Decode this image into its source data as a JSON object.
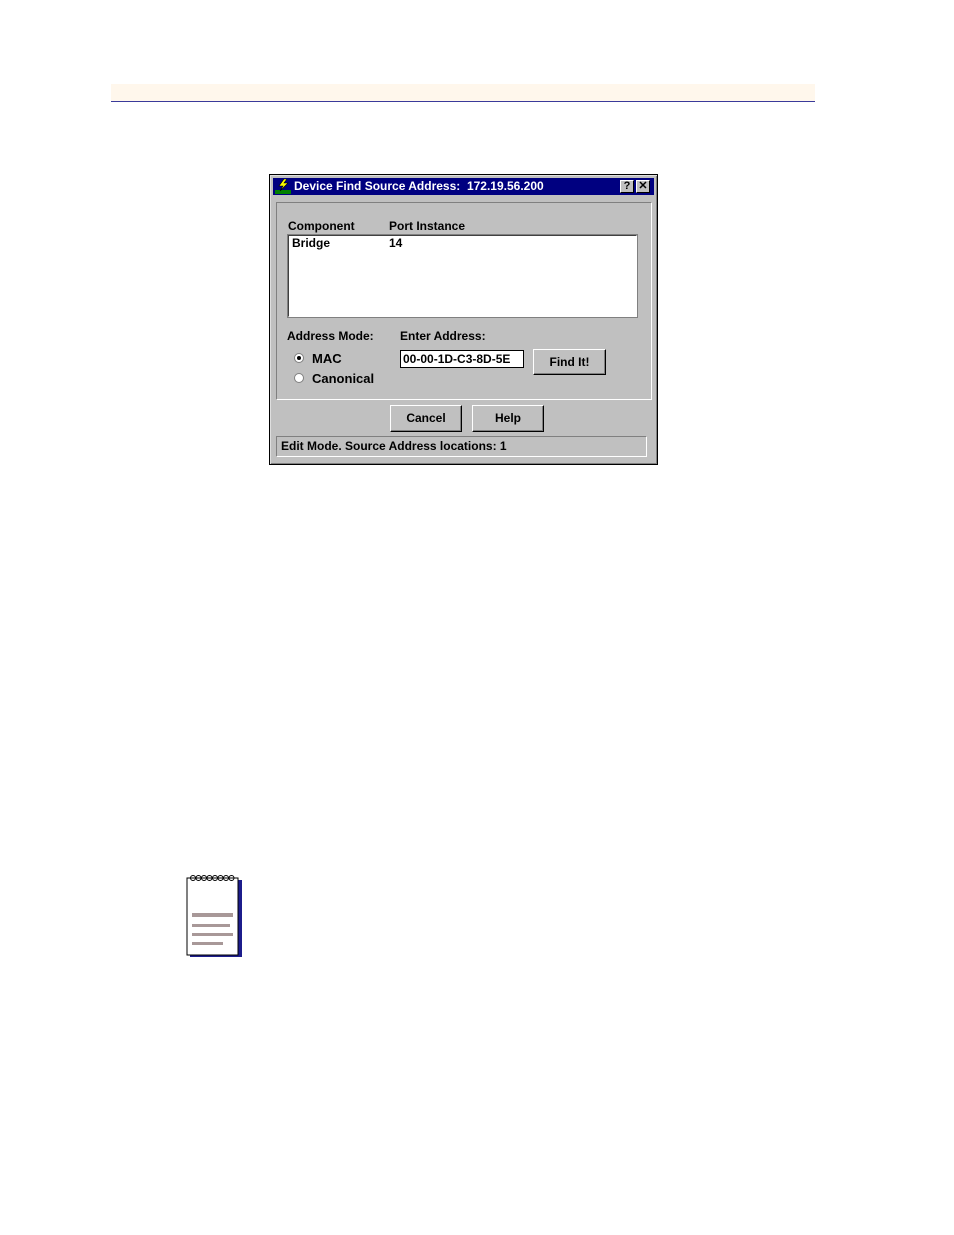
{
  "dialog": {
    "title": "Device Find Source Address:  172.19.56.200",
    "help_glyph": "?",
    "close_glyph": "✕",
    "columns": [
      "Component",
      "Port Instance"
    ],
    "rows": [
      {
        "component": "Bridge",
        "port_instance": "14"
      }
    ],
    "address_mode_label": "Address Mode:",
    "radio_mac_label": "MAC",
    "radio_canonical_label": "Canonical",
    "selected_mode": "MAC",
    "enter_address_label": "Enter Address:",
    "address_value": "00-00-1D-C3-8D-5E",
    "find_button": "Find It!",
    "cancel_button": "Cancel",
    "help_button": "Help",
    "status_text": "Edit Mode. Source Address locations: 1"
  },
  "colors": {
    "titlebar": "#000080",
    "dialog_bg": "#c0c0c0",
    "header_band": "#fff7ec",
    "header_rule": "#3a3a9a"
  },
  "icons": {
    "dialog_app_icon": "lightning-app-icon",
    "note_icon": "notepad-icon"
  }
}
